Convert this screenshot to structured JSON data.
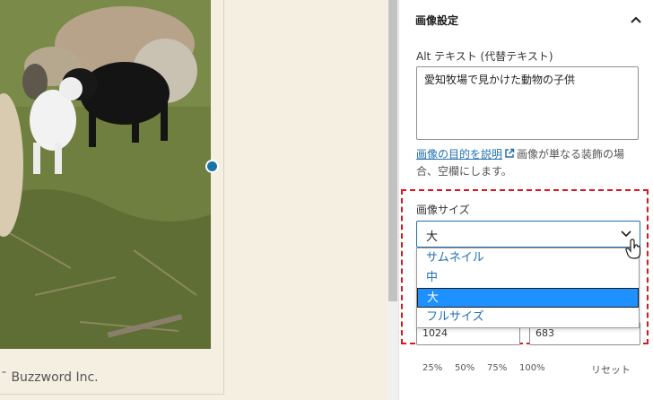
{
  "canvas": {
    "caption": "¯ Buzzword Inc.",
    "photo_alt": "愛知牧場で見かけた動物の子供"
  },
  "panel": {
    "title": "画像設定",
    "alt_label": "Alt テキスト (代替テキスト)",
    "alt_value": "愛知牧場で見かけた動物の子供",
    "help_link": "画像の目的を説明",
    "help_text": "画像が単なる装飾の場合、空欄にします。",
    "size_label": "画像サイズ",
    "size_selected": "大",
    "size_options": [
      "サムネイル",
      "中",
      "大",
      "フルサイズ"
    ],
    "width_value": "1024",
    "height_value": "683",
    "percent_buttons": [
      "25%",
      "50%",
      "75%",
      "100%"
    ],
    "reset_label": "リセット"
  },
  "colors": {
    "accent": "#2271b1",
    "highlight_border": "#e0141e",
    "selected_option": "#1e90ff",
    "canvas_background": "#f4efe0"
  },
  "icons": {
    "collapse": "chevron-up-icon",
    "external_link": "external-link-icon",
    "select": "chevron-down-icon",
    "pointer": "hand-cursor-icon"
  }
}
